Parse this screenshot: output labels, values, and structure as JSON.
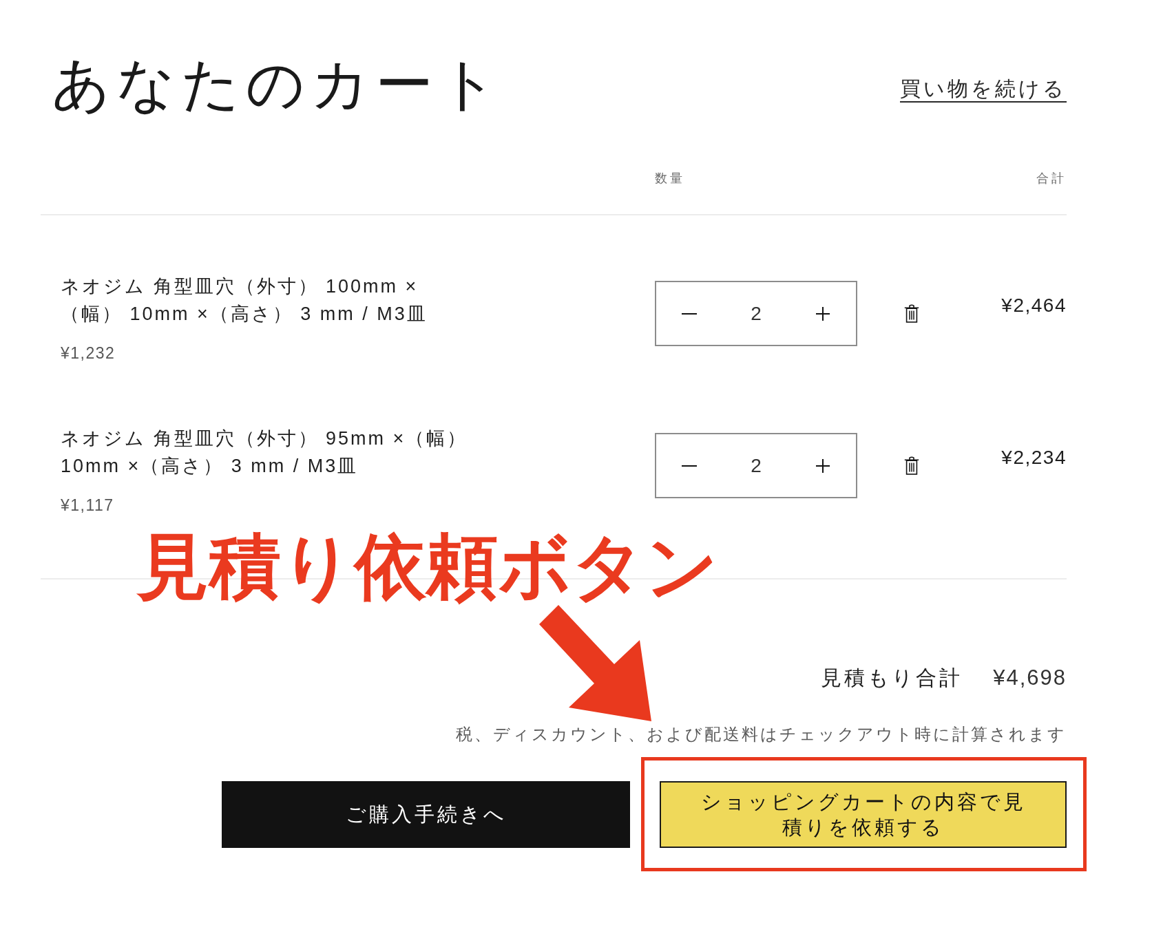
{
  "page": {
    "title": "あなたのカート",
    "continue_link": "買い物を続ける"
  },
  "table": {
    "quantity_header": "数量",
    "total_header": "合計",
    "rows": [
      {
        "name": "ネオジム 角型皿穴（外寸） 100mm ×（幅） 10mm ×（高さ） 3 mm / M3皿",
        "unit_price": "¥1,232",
        "quantity": "2",
        "line_total": "¥2,464"
      },
      {
        "name": "ネオジム 角型皿穴（外寸） 95mm ×（幅） 10mm ×（高さ） 3 mm / M3皿",
        "unit_price": "¥1,117",
        "quantity": "2",
        "line_total": "¥2,234"
      }
    ]
  },
  "summary": {
    "label": "見積もり合計",
    "value": "¥4,698",
    "note": "税、ディスカウント、および配送料はチェックアウト時に計算されます"
  },
  "buttons": [
    {
      "kind": "checkout",
      "label": "ご購入手続きへ",
      "highlighted": false
    },
    {
      "kind": "quote",
      "label": "ショッピングカートの内容で見積りを依頼する",
      "highlighted": true
    }
  ],
  "annotation": {
    "label": "見積り依頼ボタン"
  }
}
